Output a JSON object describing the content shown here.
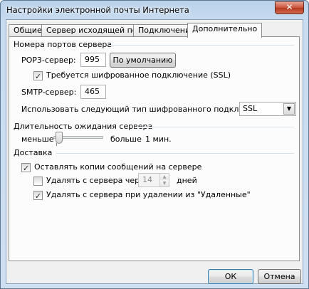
{
  "window": {
    "title": "Настройки электронной почты Интернета",
    "close_glyph": "✕"
  },
  "tabs": [
    {
      "label": "Общие"
    },
    {
      "label": "Сервер исходящей почты"
    },
    {
      "label": "Подключение"
    },
    {
      "label": "Дополнительно"
    }
  ],
  "ports": {
    "group_label": "Номера портов сервера",
    "pop3_label": "POP3-сервер:",
    "pop3_value": "995",
    "default_button": "По умолчанию",
    "ssl_required_label": "Требуется шифрованное подключение (SSL)",
    "ssl_required_checked": true,
    "smtp_label": "SMTP-сервер:",
    "smtp_value": "465",
    "encryption_label": "Использовать следующий тип шифрованного подключения:",
    "encryption_value": "SSL"
  },
  "timeout": {
    "group_label": "Длительность ожидания сервера",
    "less_label": "меньше",
    "more_label": "больше",
    "value_text": "1 мин.",
    "slider_fraction": 0.05
  },
  "delivery": {
    "group_label": "Доставка",
    "keep_copies_label": "Оставлять копии сообщений на сервере",
    "keep_copies_checked": true,
    "remove_after_label": "Удалять с сервера через",
    "remove_after_checked": false,
    "remove_after_days": "14",
    "days_label": "дней",
    "remove_on_delete_label": "Удалять с сервера при удалении из \"Удаленные\"",
    "remove_on_delete_checked": true
  },
  "footer": {
    "ok_label": "ОК",
    "cancel_label": "Отмена"
  },
  "colors": {
    "titlebar": "#b9d1ea",
    "close": "#c8523a",
    "panel": "#fcfcfc"
  }
}
